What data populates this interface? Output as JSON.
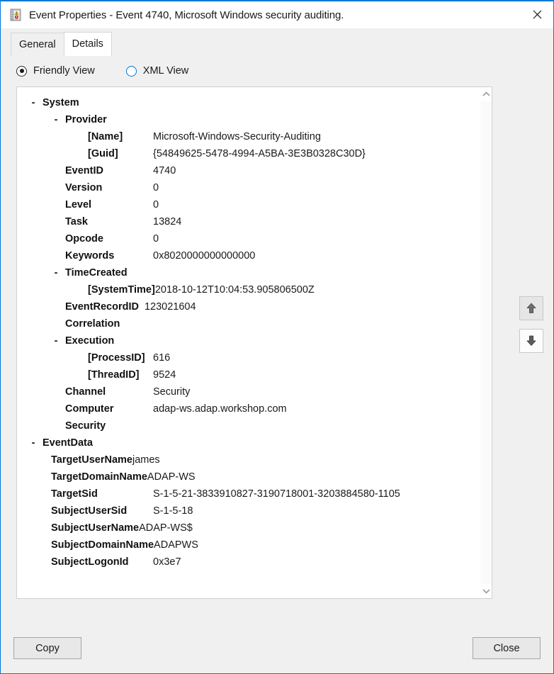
{
  "window": {
    "title": "Event Properties - Event 4740, Microsoft Windows security auditing.",
    "icon": "event-log-icon",
    "close_icon": "close-icon",
    "border_color": "#0078d7"
  },
  "tabs": [
    {
      "label": "General",
      "active": false
    },
    {
      "label": "Details",
      "active": true
    }
  ],
  "view_modes": [
    {
      "label": "Friendly View",
      "selected": true
    },
    {
      "label": "XML View",
      "selected": false
    }
  ],
  "tree": [
    {
      "indent": 0,
      "expander": "-",
      "label": "System",
      "value": "",
      "style": "node"
    },
    {
      "indent": 1,
      "expander": "-",
      "label": "Provider",
      "value": "",
      "style": "node"
    },
    {
      "indent": 2,
      "expander": "",
      "label": "[Name]",
      "value": "Microsoft-Windows-Security-Auditing",
      "style": "attr"
    },
    {
      "indent": 2,
      "expander": "",
      "label": "[Guid]",
      "value": "{54849625-5478-4994-A5BA-3E3B0328C30D}",
      "style": "attr"
    },
    {
      "indent": 1,
      "expander": "",
      "label": "EventID",
      "value": "4740",
      "style": "field"
    },
    {
      "indent": 1,
      "expander": "",
      "label": "Version",
      "value": "0",
      "style": "field"
    },
    {
      "indent": 1,
      "expander": "",
      "label": "Level",
      "value": "0",
      "style": "field"
    },
    {
      "indent": 1,
      "expander": "",
      "label": "Task",
      "value": "13824",
      "style": "field"
    },
    {
      "indent": 1,
      "expander": "",
      "label": "Opcode",
      "value": "0",
      "style": "field"
    },
    {
      "indent": 1,
      "expander": "",
      "label": "Keywords",
      "value": "0x8020000000000000",
      "style": "field"
    },
    {
      "indent": 1,
      "expander": "-",
      "label": "TimeCreated",
      "value": "",
      "style": "node"
    },
    {
      "indent": 2,
      "expander": "",
      "label": "[SystemTime]",
      "value": "2018-10-12T10:04:53.905806500Z",
      "style": "attr-tight"
    },
    {
      "indent": 1,
      "expander": "",
      "label": "EventRecordID",
      "value": "123021604",
      "style": "field-tight"
    },
    {
      "indent": 1,
      "expander": "",
      "label": "Correlation",
      "value": "",
      "style": "field"
    },
    {
      "indent": 1,
      "expander": "-",
      "label": "Execution",
      "value": "",
      "style": "node"
    },
    {
      "indent": 2,
      "expander": "",
      "label": "[ProcessID]",
      "value": "616",
      "style": "attr"
    },
    {
      "indent": 2,
      "expander": "",
      "label": "[ThreadID]",
      "value": "9524",
      "style": "attr"
    },
    {
      "indent": 1,
      "expander": "",
      "label": "Channel",
      "value": "Security",
      "style": "field"
    },
    {
      "indent": 1,
      "expander": "",
      "label": "Computer",
      "value": "adap-ws.adap.workshop.com",
      "style": "field"
    },
    {
      "indent": 1,
      "expander": "",
      "label": "Security",
      "value": "",
      "style": "field"
    },
    {
      "indent": 0,
      "expander": "-",
      "label": "EventData",
      "value": "",
      "style": "node"
    },
    {
      "indent": 1,
      "expander": "",
      "label": "TargetUserName",
      "value": "james",
      "style": "ed-tight"
    },
    {
      "indent": 1,
      "expander": "",
      "label": "TargetDomainName",
      "value": "ADAP-WS",
      "style": "ed-tight"
    },
    {
      "indent": 1,
      "expander": "",
      "label": "TargetSid",
      "value": "S-1-5-21-3833910827-3190718001-3203884580-1105",
      "style": "ed-col"
    },
    {
      "indent": 1,
      "expander": "",
      "label": "SubjectUserSid",
      "value": "S-1-5-18",
      "style": "ed-col"
    },
    {
      "indent": 1,
      "expander": "",
      "label": "SubjectUserName",
      "value": "ADAP-WS$",
      "style": "ed-tight"
    },
    {
      "indent": 1,
      "expander": "",
      "label": "SubjectDomainName",
      "value": "ADAPWS",
      "style": "ed-tight"
    },
    {
      "indent": 1,
      "expander": "",
      "label": "SubjectLogonId",
      "value": "0x3e7",
      "style": "ed-col"
    }
  ],
  "scrollbar": {
    "up_icon": "chevron-up-icon",
    "down_icon": "chevron-down-icon"
  },
  "sidenav": [
    {
      "name": "previous-event-button",
      "icon": "arrow-up-icon"
    },
    {
      "name": "next-event-button",
      "icon": "arrow-down-icon"
    }
  ],
  "footer": {
    "copy_label": "Copy",
    "close_label": "Close"
  }
}
